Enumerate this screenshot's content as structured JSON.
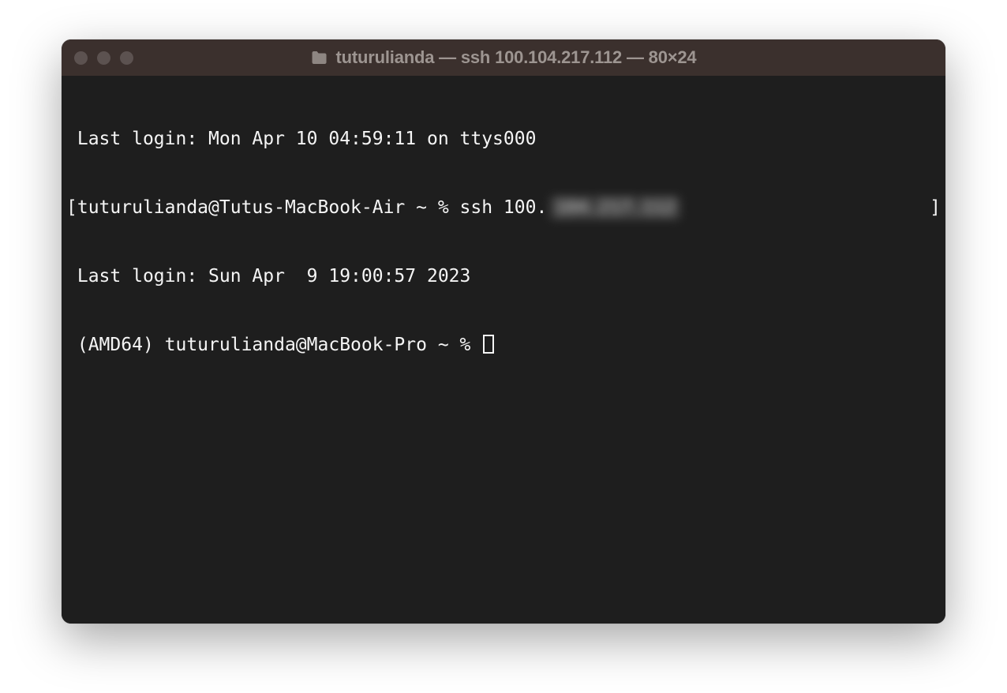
{
  "window": {
    "title": "tuturulianda — ssh 100.104.217.112 — 80×24"
  },
  "terminal": {
    "line1": "Last login: Mon Apr 10 04:59:11 on ttys000",
    "prompt_open": "[",
    "prompt_text": "tuturulianda@Tutus-MacBook-Air ~ % ssh 100.",
    "blurred_ip": "104.217.112",
    "prompt_close": "]",
    "line3": "Last login: Sun Apr  9 19:00:57 2023",
    "line4": "(AMD64) tuturulianda@MacBook-Pro ~ % "
  }
}
